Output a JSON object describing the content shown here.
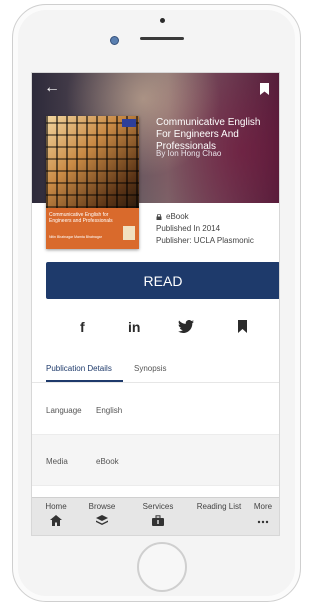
{
  "book": {
    "title": "Communicative English For Engineers And Professionals",
    "author": "By Ion Hong Chao",
    "format": "eBook",
    "published": "Published In 2014",
    "publisher": "Publisher: UCLA Plasmonic",
    "cover_title": "Communicative English for Engineers and Professionals",
    "cover_authors": "Nitin Bhatnagar   Mamta Bhatnagar"
  },
  "actions": {
    "read_label": "READ"
  },
  "social": {
    "facebook": "f",
    "linkedin": "in"
  },
  "tabs": [
    {
      "label": "Publication Details",
      "active": true
    },
    {
      "label": "Synopsis",
      "active": false
    }
  ],
  "details": [
    {
      "key": "Language",
      "value": "English"
    },
    {
      "key": "Media",
      "value": "eBook"
    }
  ],
  "tabbar": [
    {
      "label": "Home",
      "icon": "home-icon"
    },
    {
      "label": "Browse",
      "icon": "layers-icon"
    },
    {
      "label": "Services",
      "icon": "briefcase-icon"
    },
    {
      "label": "Reading List",
      "icon": "reading-list-icon"
    },
    {
      "label": "More",
      "icon": "more-icon"
    }
  ],
  "colors": {
    "primary": "#1e3a6b",
    "cover_band": "#d96a2c"
  }
}
